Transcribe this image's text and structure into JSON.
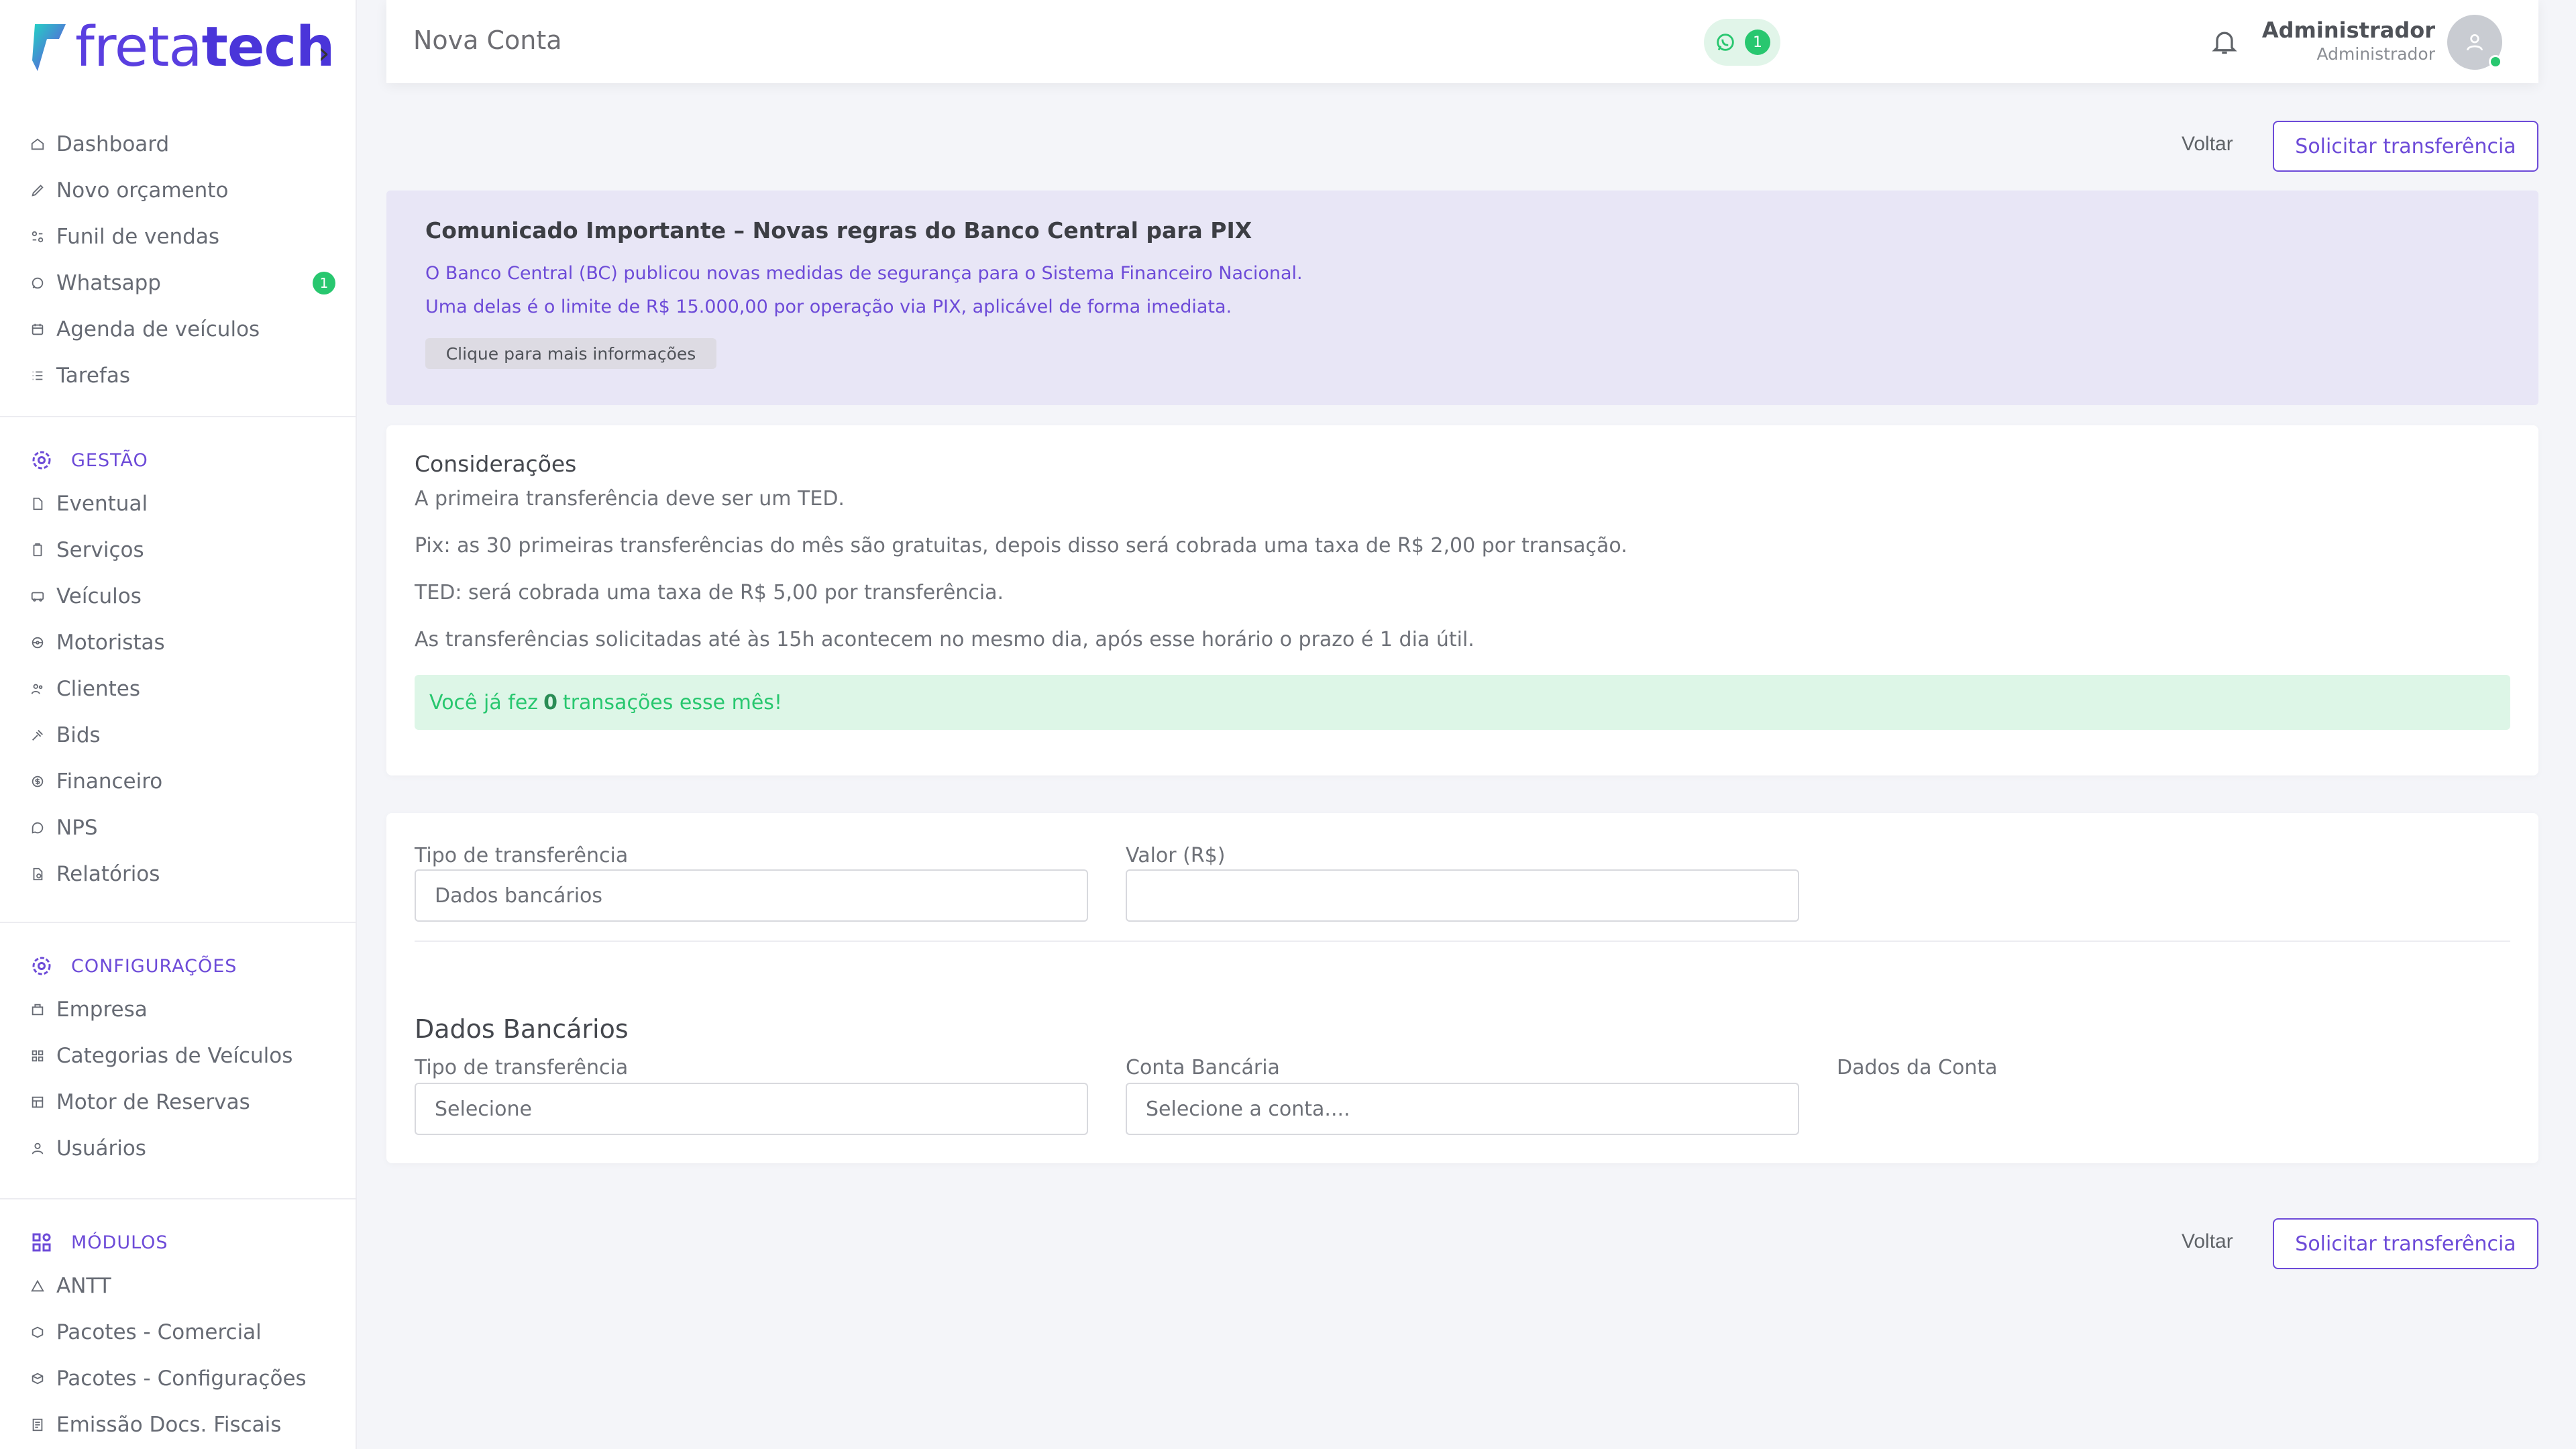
{
  "brand": {
    "logo_light": "freta",
    "logo_bold": "tech",
    "chevron": "›",
    "accent": "#6d4bd8",
    "success": "#28c76f"
  },
  "sidebar": {
    "main_items": [
      {
        "label": "Dashboard",
        "icon": "home-icon"
      },
      {
        "label": "Novo orçamento",
        "icon": "edit-icon"
      },
      {
        "label": "Funil de vendas",
        "icon": "funnel-icon"
      },
      {
        "label": "Whatsapp",
        "icon": "whatsapp-icon",
        "badge": "1"
      },
      {
        "label": "Agenda de veículos",
        "icon": "calendar-icon"
      },
      {
        "label": "Tarefas",
        "icon": "list-icon"
      }
    ],
    "gestao": {
      "title": "GESTÃO",
      "items": [
        {
          "label": "Eventual",
          "icon": "document-icon"
        },
        {
          "label": "Serviços",
          "icon": "clipboard-icon"
        },
        {
          "label": "Veículos",
          "icon": "bus-icon"
        },
        {
          "label": "Motoristas",
          "icon": "steering-wheel-icon"
        },
        {
          "label": "Clientes",
          "icon": "users-icon"
        },
        {
          "label": "Bids",
          "icon": "gavel-icon"
        },
        {
          "label": "Financeiro",
          "icon": "dollar-icon"
        },
        {
          "label": "NPS",
          "icon": "chat-icon"
        },
        {
          "label": "Relatórios",
          "icon": "report-icon"
        }
      ]
    },
    "configuracoes": {
      "title": "CONFIGURAÇÕES",
      "items": [
        {
          "label": "Empresa",
          "icon": "building-icon"
        },
        {
          "label": "Categorias de Veículos",
          "icon": "grid-icon"
        },
        {
          "label": "Motor de Reservas",
          "icon": "table-icon"
        },
        {
          "label": "Usuários",
          "icon": "user-icon"
        }
      ]
    },
    "modulos": {
      "title": "MÓDULOS",
      "items": [
        {
          "label": "ANTT",
          "icon": "triangle-icon"
        },
        {
          "label": "Pacotes - Comercial",
          "icon": "package-icon"
        },
        {
          "label": "Pacotes - Configurações",
          "icon": "package-settings-icon"
        },
        {
          "label": "Emissão Docs. Fiscais",
          "icon": "invoice-icon"
        }
      ]
    }
  },
  "header": {
    "title": "Nova Conta",
    "whatsapp_count": "1",
    "user_name": "Administrador",
    "user_role": "Administrador"
  },
  "actions": {
    "back_label": "Voltar",
    "submit_label": "Solicitar transferência"
  },
  "notice": {
    "title": "Comunicado Importante – Novas regras do Banco Central para PIX",
    "line1": "O Banco Central (BC) publicou novas medidas de segurança para o Sistema Financeiro Nacional.",
    "line2": "Uma delas é o limite de R$ 15.000,00 por operação via PIX, aplicável de forma imediata.",
    "button": "Clique para mais informações"
  },
  "consideracoes": {
    "title": "Considerações",
    "lines": [
      "A primeira transferência deve ser um TED.",
      "Pix: as 30 primeiras transferências do mês são gratuitas, depois disso será cobrada uma taxa de R$ 2,00 por transação.",
      "TED: será cobrada uma taxa de R$ 5,00 por transferência.",
      "As transferências solicitadas até às 15h acontecem no mesmo dia, após esse horário o prazo é 1 dia útil."
    ],
    "alert_prefix": "Você já fez",
    "alert_count": "0",
    "alert_suffix": "transações esse mês!"
  },
  "form": {
    "tipo_label": "Tipo de transferência",
    "tipo_value": "Dados bancários",
    "valor_label": "Valor (R$)",
    "valor_value": "",
    "dados_heading": "Dados Bancários",
    "tipo2_label": "Tipo de transferência",
    "tipo2_value": "Selecione",
    "conta_label": "Conta Bancária",
    "conta_value": "Selecione a conta....",
    "dados_conta_label": "Dados da Conta"
  }
}
